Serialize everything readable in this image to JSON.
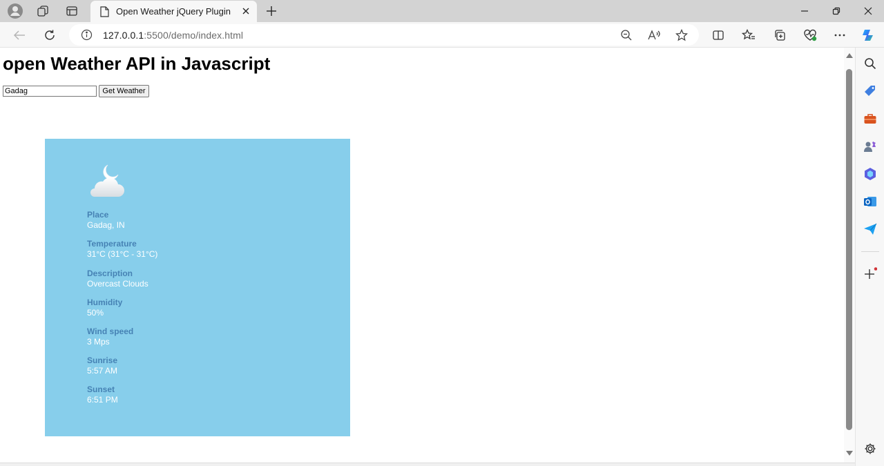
{
  "browser": {
    "tab": {
      "title": "Open Weather jQuery Plugin"
    },
    "address": {
      "host": "127.0.0.1",
      "rest": ":5500/demo/index.html"
    }
  },
  "page": {
    "title": "open Weather API in Javascript",
    "city_input": {
      "value": "Gadag"
    },
    "get_button": "Get Weather",
    "weather_icon": "partly-cloudy-night-icon",
    "weather": [
      {
        "label": "Place",
        "value": "Gadag, IN"
      },
      {
        "label": "Temperature",
        "value": "31°C (31°C - 31°C)"
      },
      {
        "label": "Description",
        "value": "Overcast Clouds"
      },
      {
        "label": "Humidity",
        "value": "50%"
      },
      {
        "label": "Wind speed",
        "value": "3 Mps"
      },
      {
        "label": "Sunrise",
        "value": "5:57 AM"
      },
      {
        "label": "Sunset",
        "value": "6:51 PM"
      }
    ]
  },
  "colors": {
    "card_background": "#87ceeb",
    "label_color": "#4682b4",
    "value_color": "#ffffff"
  }
}
